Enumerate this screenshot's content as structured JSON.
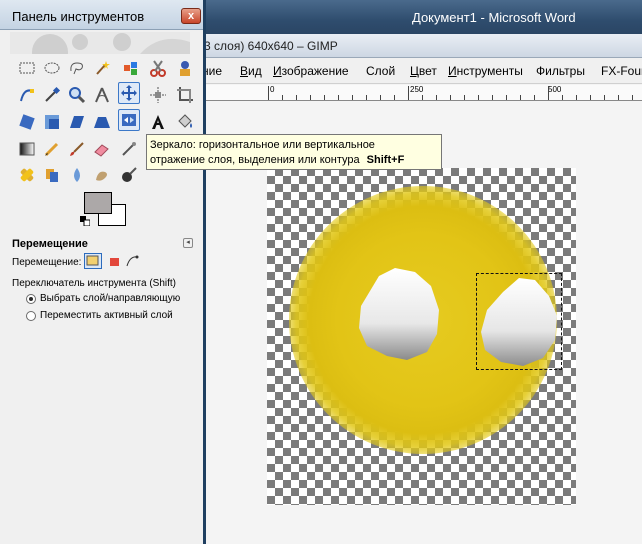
{
  "word": {
    "title": "Документ1 - Microsoft Word"
  },
  "gimp": {
    "title": "3 слоя) 640x640 – GIMP",
    "menu": [
      {
        "label": "ние",
        "mnemonic": ""
      },
      {
        "label": "Вид",
        "mnemonic": "В"
      },
      {
        "label": "Изображение",
        "mnemonic": "И"
      },
      {
        "label": "Слой",
        "mnemonic": ""
      },
      {
        "label": "Цвет",
        "mnemonic": "Ц"
      },
      {
        "label": "Инструменты",
        "mnemonic": "И"
      },
      {
        "label": "Фильтры",
        "mnemonic": ""
      },
      {
        "label": "FX-Foundry",
        "mnemonic": ""
      }
    ],
    "ruler_labels": [
      "0",
      "250",
      "500"
    ]
  },
  "toolbox": {
    "title": "Панель инструментов",
    "close_label": "x",
    "tools": [
      {
        "icon": "rect-select-icon"
      },
      {
        "icon": "ellipse-select-icon"
      },
      {
        "icon": "free-select-icon"
      },
      {
        "icon": "fuzzy-select-icon"
      },
      {
        "icon": "color-select-icon"
      },
      {
        "icon": "scissors-icon"
      },
      {
        "icon": "foreground-select-icon"
      },
      {
        "icon": "paths-icon"
      },
      {
        "icon": "color-picker-icon"
      },
      {
        "icon": "zoom-icon"
      },
      {
        "icon": "measure-icon"
      },
      {
        "icon": "move-icon",
        "active": true
      },
      {
        "icon": "align-icon"
      },
      {
        "icon": "crop-icon"
      },
      {
        "icon": "rotate-icon"
      },
      {
        "icon": "scale-icon"
      },
      {
        "icon": "shear-icon"
      },
      {
        "icon": "perspective-icon"
      },
      {
        "icon": "flip-icon",
        "active": true
      },
      {
        "icon": "text-icon"
      },
      {
        "icon": "bucket-fill-icon"
      },
      {
        "icon": "blend-icon"
      },
      {
        "icon": "pencil-icon"
      },
      {
        "icon": "paintbrush-icon"
      },
      {
        "icon": "eraser-icon"
      },
      {
        "icon": "airbrush-icon"
      },
      {
        "icon": "ink-icon"
      },
      {
        "icon": "heal-icon"
      },
      {
        "icon": "clone-icon"
      },
      {
        "icon": "blur-icon"
      },
      {
        "icon": "smudge-icon"
      },
      {
        "icon": "dodge-burn-icon"
      }
    ],
    "fg_color": "#aca8a8",
    "bg_color": "#ffffff"
  },
  "options": {
    "header": "Перемещение",
    "move_label": "Перемещение:",
    "switch_label": "Переключатель инструмента  (Shift)",
    "radios": [
      {
        "label": "Выбрать слой/направляющую",
        "checked": true
      },
      {
        "label": "Переместить активный слой",
        "checked": false
      }
    ]
  },
  "tooltip": {
    "line1": "Зеркало: горизонтальное или вертикальное",
    "line2": "отражение слоя, выделения или контура",
    "shortcut_mod": "Shift",
    "shortcut_plus": "+",
    "shortcut_key": "F"
  },
  "colors": {
    "glow": "#e2c416",
    "checker_dark": "#7b7b7b",
    "selection_border": "#111111",
    "titlebar_word": "#2f4d6e"
  }
}
